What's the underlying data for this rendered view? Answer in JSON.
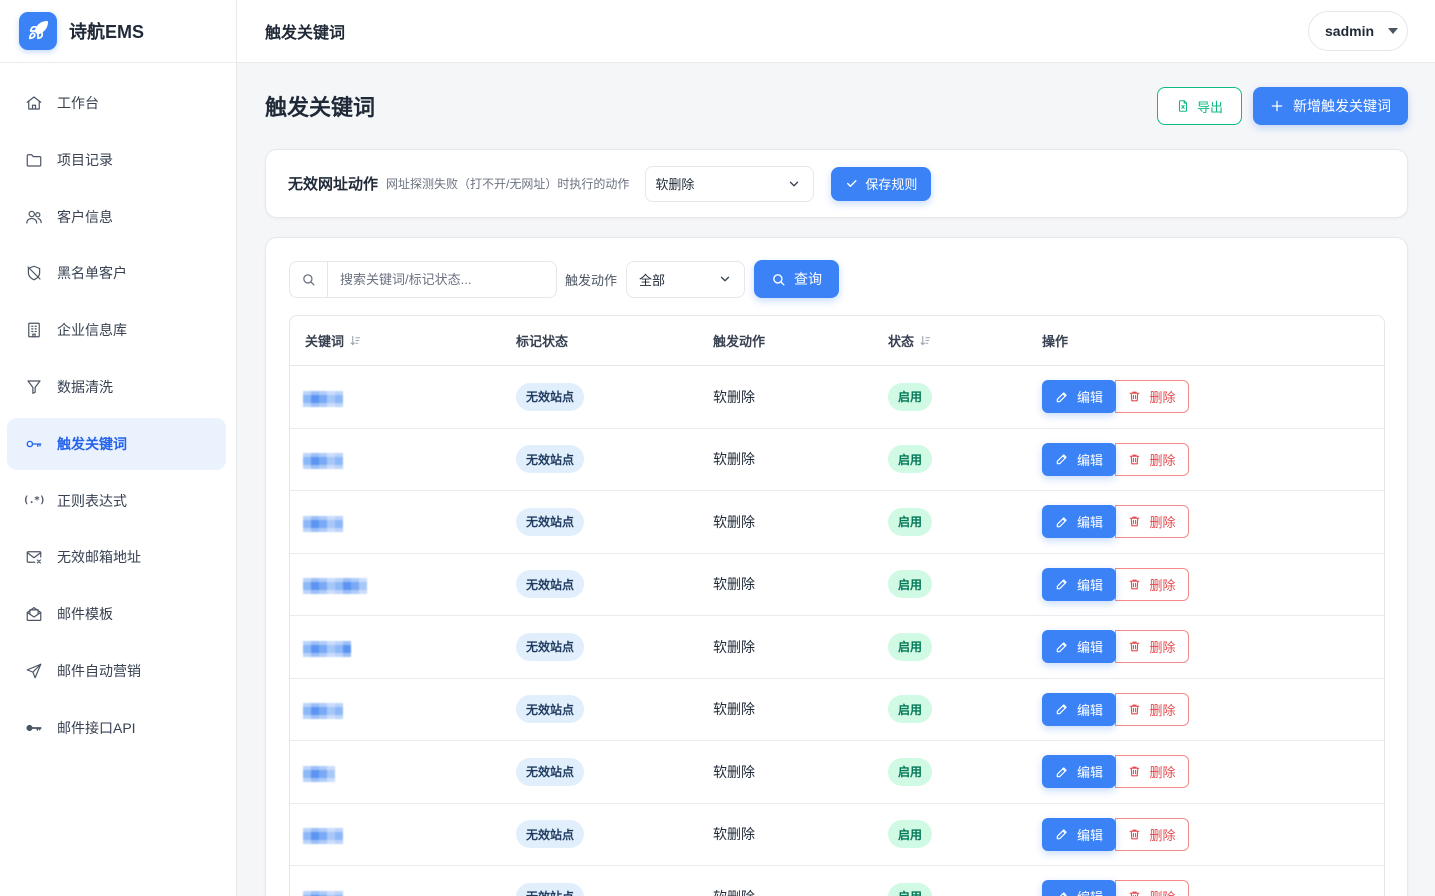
{
  "app": {
    "name": "诗航EMS",
    "logo_icon": "rocket-icon"
  },
  "sidebar": {
    "items": [
      {
        "label": "工作台",
        "icon": "home-icon",
        "active": false
      },
      {
        "label": "项目记录",
        "icon": "folder-icon",
        "active": false
      },
      {
        "label": "客户信息",
        "icon": "users-icon",
        "active": false
      },
      {
        "label": "黑名单客户",
        "icon": "shield-off-icon",
        "active": false
      },
      {
        "label": "企业信息库",
        "icon": "building-icon",
        "active": false
      },
      {
        "label": "数据清洗",
        "icon": "filter-icon",
        "active": false
      },
      {
        "label": "触发关键词",
        "icon": "key-icon",
        "active": true
      },
      {
        "label": "正则表达式",
        "icon": "regex-icon",
        "icon_text": "(.*)",
        "active": false
      },
      {
        "label": "无效邮箱地址",
        "icon": "mail-x-icon",
        "active": false
      },
      {
        "label": "邮件模板",
        "icon": "mail-open-icon",
        "active": false
      },
      {
        "label": "邮件自动营销",
        "icon": "send-icon",
        "active": false
      },
      {
        "label": "邮件接口API",
        "icon": "api-key-icon",
        "active": false
      }
    ]
  },
  "header": {
    "title": "触发关键词",
    "user": {
      "name": "sadmin",
      "icon": "caret-down-icon"
    }
  },
  "page": {
    "title": "触发关键词",
    "export_button": {
      "label": "导出",
      "icon": "file-excel-icon"
    },
    "add_button": {
      "label": "新增触发关键词",
      "icon": "plus-icon"
    }
  },
  "rule_card": {
    "title": "无效网址动作",
    "description": "网址探测失败（打不开/无网址）时执行的动作",
    "action_select": {
      "value": "软删除",
      "icon": "chevron-down-icon"
    },
    "save_button": {
      "label": "保存规则",
      "icon": "check-icon"
    }
  },
  "filter": {
    "search": {
      "placeholder": "搜索关键词/标记状态...",
      "icon": "search-icon"
    },
    "action_label": "触发动作",
    "action_select": {
      "value": "全部",
      "icon": "chevron-down-icon"
    },
    "query_button": {
      "label": "查询",
      "icon": "search-icon"
    }
  },
  "table": {
    "columns": [
      {
        "label": "关键词",
        "sortable": true
      },
      {
        "label": "标记状态",
        "sortable": false
      },
      {
        "label": "触发动作",
        "sortable": false
      },
      {
        "label": "状态",
        "sortable": true
      },
      {
        "label": "操作",
        "sortable": false
      }
    ],
    "row_actions": {
      "edit_label": "编辑",
      "edit_icon": "pencil-icon",
      "delete_label": "删除",
      "delete_icon": "trash-icon"
    },
    "rows": [
      {
        "mark_status": "无效站点",
        "action": "软删除",
        "status": "启用"
      },
      {
        "mark_status": "无效站点",
        "action": "软删除",
        "status": "启用"
      },
      {
        "mark_status": "无效站点",
        "action": "软删除",
        "status": "启用"
      },
      {
        "mark_status": "无效站点",
        "action": "软删除",
        "status": "启用"
      },
      {
        "mark_status": "无效站点",
        "action": "软删除",
        "status": "启用"
      },
      {
        "mark_status": "无效站点",
        "action": "软删除",
        "status": "启用"
      },
      {
        "mark_status": "无效站点",
        "action": "软删除",
        "status": "启用"
      },
      {
        "mark_status": "无效站点",
        "action": "软删除",
        "status": "启用"
      },
      {
        "mark_status": "无效站点",
        "action": "软删除",
        "status": "启用"
      }
    ]
  },
  "colors": {
    "primary": "#3b82f6",
    "active_nav_bg": "#eaf2fe",
    "success": "#10b981",
    "danger": "#ef4444",
    "page_bg": "#f5f6f8"
  }
}
